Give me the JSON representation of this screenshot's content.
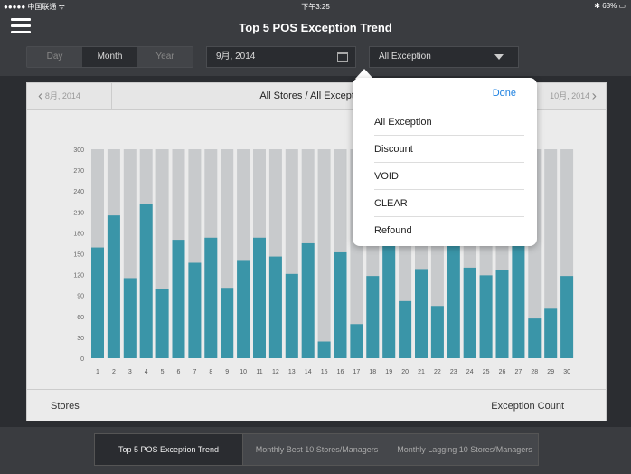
{
  "status_bar": {
    "carrier": "●●●●● 中国联通 ᯤ",
    "time": "下午3:25",
    "battery": "✱ 68% ▭"
  },
  "nav": {
    "title": "Top 5 POS Exception Trend"
  },
  "toolbar": {
    "period_segments": [
      "Day",
      "Month",
      "Year"
    ],
    "selected_period": "Month",
    "date_value": "9月, 2014",
    "exception_value": "All Exception"
  },
  "panel": {
    "prev_month": "8月, 2014",
    "title": "All Stores / All Exception /",
    "next_month": "10月, 2014",
    "footer_left": "Stores",
    "footer_right": "Exception Count"
  },
  "chart_data": {
    "type": "bar",
    "categories": [
      "1",
      "2",
      "3",
      "4",
      "5",
      "6",
      "7",
      "8",
      "9",
      "10",
      "11",
      "12",
      "13",
      "14",
      "15",
      "16",
      "17",
      "18",
      "19",
      "20",
      "21",
      "22",
      "23",
      "24",
      "25",
      "26",
      "27",
      "28",
      "29",
      "30"
    ],
    "values": [
      159,
      205,
      115,
      221,
      99,
      170,
      137,
      173,
      101,
      141,
      173,
      146,
      121,
      165,
      24,
      152,
      49,
      118,
      167,
      82,
      128,
      75,
      170,
      130,
      119,
      127,
      174,
      57,
      71,
      118
    ],
    "yticks": [
      0,
      30,
      60,
      90,
      120,
      150,
      180,
      210,
      240,
      270,
      300
    ],
    "ylim": [
      0,
      300
    ],
    "bar_color": "#3a95a8",
    "background_bar_color": "#c8cacc"
  },
  "popover": {
    "done_label": "Done",
    "options": [
      "All Exception",
      "Discount",
      "VOID",
      "CLEAR",
      "Refound"
    ]
  },
  "bottom_tabs": {
    "items": [
      "Top 5 POS Exception Trend",
      "Monthly Best 10 Stores/Managers",
      "Monthly Lagging 10 Stores/Managers"
    ],
    "active": "Top 5 POS Exception Trend"
  }
}
